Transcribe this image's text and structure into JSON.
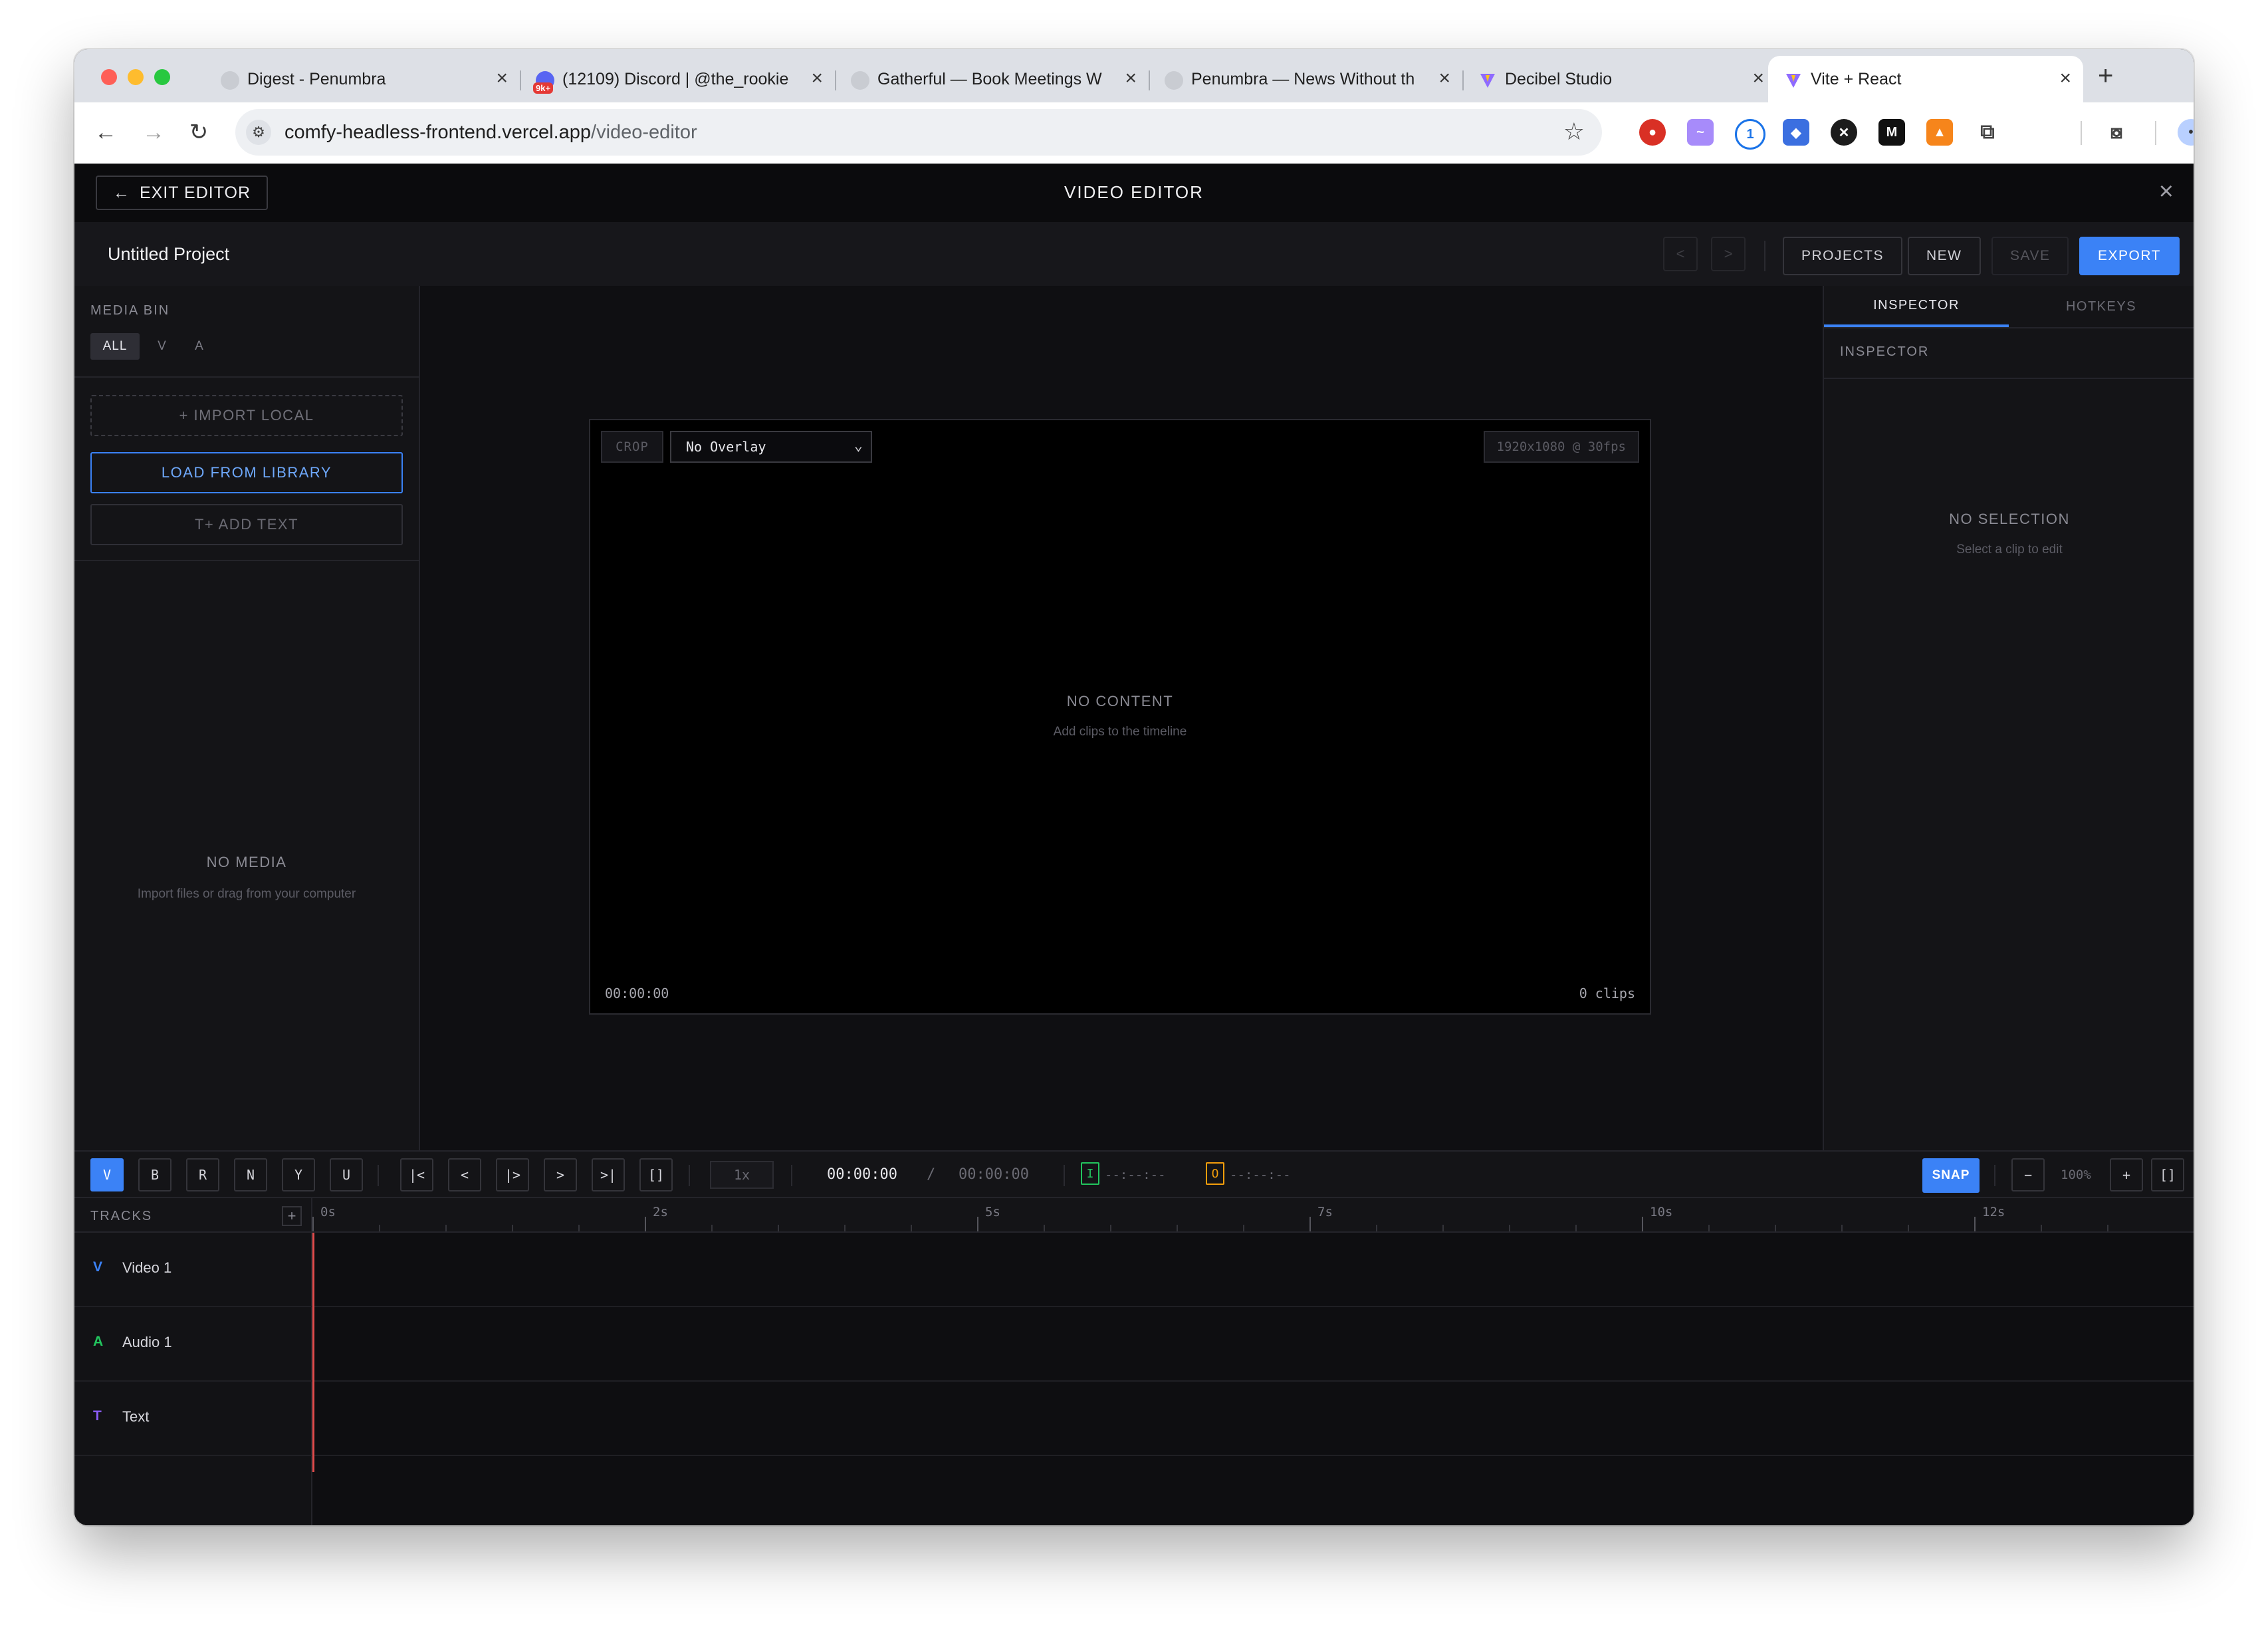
{
  "browser": {
    "tabs": [
      {
        "title": "Digest - Penumbra",
        "favicon": "globe-icon",
        "active": false
      },
      {
        "title": "(12109) Discord | @the_rookie",
        "favicon": "discord-icon",
        "badge": "9k+",
        "active": false
      },
      {
        "title": "Gatherful — Book Meetings W",
        "favicon": "globe-icon",
        "active": false
      },
      {
        "title": "Penumbra — News Without th",
        "favicon": "globe-icon",
        "active": false
      },
      {
        "title": "Decibel Studio",
        "favicon": "vite-icon",
        "active": false
      },
      {
        "title": "Vite + React",
        "favicon": "vite-icon",
        "active": true
      }
    ],
    "address": {
      "host": "comfy-headless-frontend.vercel.app",
      "path": "/video-editor"
    }
  },
  "header": {
    "exit_label": "EXIT EDITOR",
    "title": "VIDEO EDITOR"
  },
  "project": {
    "name": "Untitled Project",
    "undo": "<",
    "redo": ">",
    "buttons": {
      "projects": "PROJECTS",
      "new": "NEW",
      "save": "SAVE",
      "export": "EXPORT"
    }
  },
  "media_bin": {
    "title": "MEDIA BIN",
    "filters": [
      "ALL",
      "V",
      "A"
    ],
    "import_local": "+ IMPORT LOCAL",
    "load_library": "LOAD FROM LIBRARY",
    "add_text": "T+ ADD TEXT",
    "empty_title": "NO MEDIA",
    "empty_sub": "Import files or drag from your computer"
  },
  "preview": {
    "crop": "CROP",
    "overlay_selected": "No Overlay",
    "resolution": "1920x1080 @ 30fps",
    "empty_title": "NO CONTENT",
    "empty_sub": "Add clips to the timeline",
    "timecode": "00:00:00",
    "clip_count": "0 clips"
  },
  "inspector": {
    "tabs": [
      "INSPECTOR",
      "HOTKEYS"
    ],
    "section": "INSPECTOR",
    "empty_title": "NO SELECTION",
    "empty_sub": "Select a clip to edit"
  },
  "transport": {
    "tools": [
      "V",
      "B",
      "R",
      "N",
      "Y",
      "U"
    ],
    "nav": [
      "|<",
      "<",
      "|>",
      ">",
      ">|",
      "[]"
    ],
    "speed": "1x",
    "current_time": "00:00:00",
    "separator": "/",
    "duration": "00:00:00",
    "in_label": "I",
    "in_time": "--:--:--",
    "out_label": "O",
    "out_time": "--:--:--",
    "snap": "SNAP",
    "zoom_out": "−",
    "zoom": "100%",
    "zoom_in": "+",
    "fit": "[]"
  },
  "timeline": {
    "header": "TRACKS",
    "add": "+",
    "ruler": [
      "0s",
      "2s",
      "5s",
      "7s",
      "10s",
      "12s"
    ],
    "tracks": [
      {
        "icon": "V",
        "name": "Video 1",
        "color": "#3b82f6"
      },
      {
        "icon": "A",
        "name": "Audio 1",
        "color": "#22c55e"
      },
      {
        "icon": "T",
        "name": "Text",
        "color": "#8b5cf6"
      }
    ]
  },
  "colors": {
    "accent": "#3b82f6",
    "playhead": "#e04b4b",
    "in_mark": "#22c55e",
    "out_mark": "#f59e0b"
  }
}
